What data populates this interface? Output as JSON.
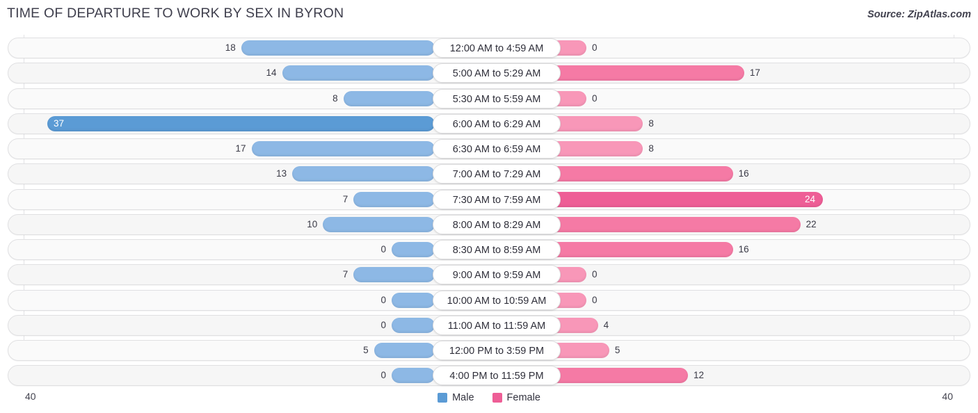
{
  "header": {
    "title": "TIME OF DEPARTURE TO WORK BY SEX IN BYRON",
    "source": "Source: ZipAtlas.com"
  },
  "axis": {
    "left_max_label": "40",
    "right_max_label": "40"
  },
  "legend": {
    "items": [
      {
        "label": "Male",
        "color": "#5b9bd5"
      },
      {
        "label": "Female",
        "color": "#ee5e96"
      }
    ]
  },
  "colors": {
    "male_normal": "#8db8e5",
    "male_high": "#5b9bd5",
    "female_normal": "#f897b8",
    "female_mid": "#f57aa5",
    "female_high": "#ee5e96",
    "track": "#fafafa",
    "text": "#3a3a46"
  },
  "chart_data": {
    "type": "bar",
    "subtype": "diverging-horizontal-bar",
    "title": "TIME OF DEPARTURE TO WORK BY SEX IN BYRON",
    "xlabel": "",
    "ylabel": "",
    "xlim": [
      40,
      40
    ],
    "axis_max": 40,
    "grid": true,
    "legend_position": "bottom-center",
    "categories": [
      "12:00 AM to 4:59 AM",
      "5:00 AM to 5:29 AM",
      "5:30 AM to 5:59 AM",
      "6:00 AM to 6:29 AM",
      "6:30 AM to 6:59 AM",
      "7:00 AM to 7:29 AM",
      "7:30 AM to 7:59 AM",
      "8:00 AM to 8:29 AM",
      "8:30 AM to 8:59 AM",
      "9:00 AM to 9:59 AM",
      "10:00 AM to 10:59 AM",
      "11:00 AM to 11:59 AM",
      "12:00 PM to 3:59 PM",
      "4:00 PM to 11:59 PM"
    ],
    "series": [
      {
        "name": "Male",
        "side": "left",
        "values": [
          18,
          14,
          8,
          37,
          17,
          13,
          7,
          10,
          0,
          7,
          0,
          0,
          5,
          0
        ]
      },
      {
        "name": "Female",
        "side": "right",
        "values": [
          0,
          17,
          0,
          8,
          8,
          16,
          24,
          22,
          16,
          0,
          0,
          4,
          5,
          12
        ]
      }
    ]
  },
  "rows": [
    {
      "label": "12:00 AM to 4:59 AM",
      "male": 18,
      "female": 0
    },
    {
      "label": "5:00 AM to 5:29 AM",
      "male": 14,
      "female": 17
    },
    {
      "label": "5:30 AM to 5:59 AM",
      "male": 8,
      "female": 0
    },
    {
      "label": "6:00 AM to 6:29 AM",
      "male": 37,
      "female": 8
    },
    {
      "label": "6:30 AM to 6:59 AM",
      "male": 17,
      "female": 8
    },
    {
      "label": "7:00 AM to 7:29 AM",
      "male": 13,
      "female": 16
    },
    {
      "label": "7:30 AM to 7:59 AM",
      "male": 7,
      "female": 24
    },
    {
      "label": "8:00 AM to 8:29 AM",
      "male": 10,
      "female": 22
    },
    {
      "label": "8:30 AM to 8:59 AM",
      "male": 0,
      "female": 16
    },
    {
      "label": "9:00 AM to 9:59 AM",
      "male": 7,
      "female": 0
    },
    {
      "label": "10:00 AM to 10:59 AM",
      "male": 0,
      "female": 0
    },
    {
      "label": "11:00 AM to 11:59 AM",
      "male": 0,
      "female": 4
    },
    {
      "label": "12:00 PM to 3:59 PM",
      "male": 5,
      "female": 5
    },
    {
      "label": "4:00 PM to 11:59 PM",
      "male": 0,
      "female": 12
    }
  ]
}
